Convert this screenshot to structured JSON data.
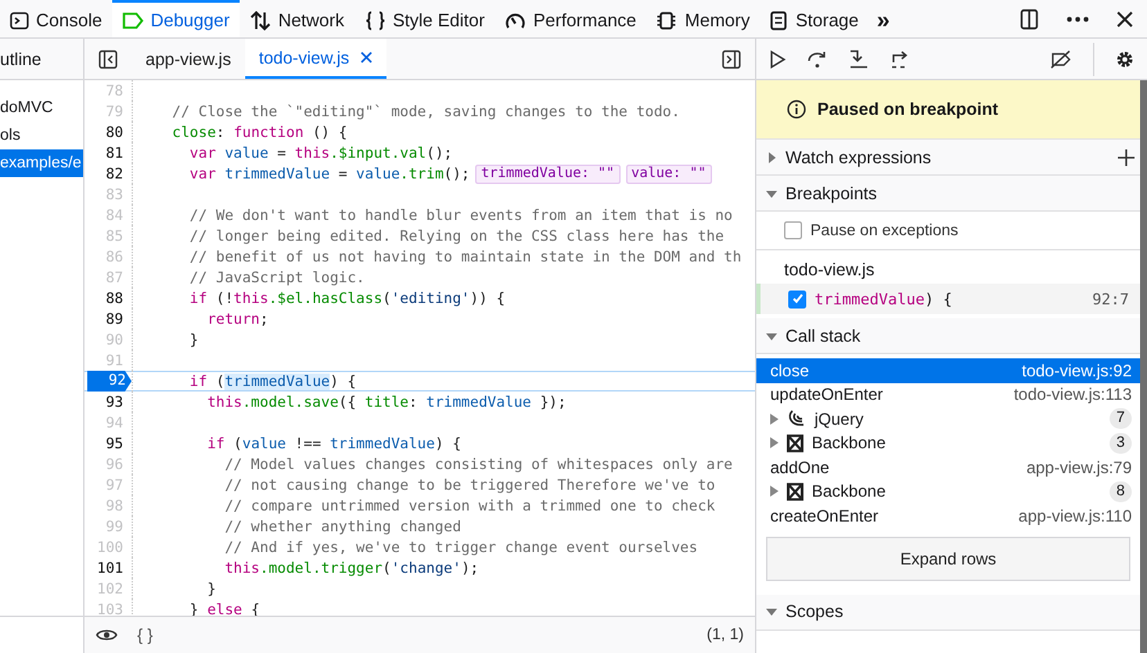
{
  "toolbox_tabs": [
    {
      "label": "Console",
      "selected": false
    },
    {
      "label": "Debugger",
      "selected": true
    },
    {
      "label": "Network",
      "selected": false
    },
    {
      "label": "Style Editor",
      "selected": false
    },
    {
      "label": "Performance",
      "selected": false
    },
    {
      "label": "Memory",
      "selected": false
    },
    {
      "label": "Storage",
      "selected": false
    }
  ],
  "overflow_button": "»",
  "sources_panel": {
    "tab": "utline",
    "items": [
      {
        "label": "doMVC",
        "selected": false
      },
      {
        "label": "ols",
        "selected": false
      },
      {
        "label": "examples/e",
        "selected": true
      }
    ]
  },
  "editor_tabs": [
    {
      "label": "app-view.js",
      "selected": false
    },
    {
      "label": "todo-view.js",
      "selected": true
    }
  ],
  "code_lines": [
    {
      "number": "78",
      "executable": false,
      "breakpoint": false
    },
    {
      "number": "79",
      "executable": false,
      "breakpoint": false,
      "tokens": [
        {
          "text": "    // Close the `\"editing\"` mode, saving changes to the todo.",
          "kind": "comment"
        }
      ]
    },
    {
      "number": "80",
      "executable": true,
      "breakpoint": false,
      "tokens": [
        {
          "text": "    close",
          "kind": "property"
        },
        {
          "text": ": ",
          "kind": "plain"
        },
        {
          "text": "function",
          "kind": "keyword"
        },
        {
          "text": " () {",
          "kind": "plain"
        }
      ]
    },
    {
      "number": "81",
      "executable": true,
      "breakpoint": false,
      "tokens": [
        {
          "text": "      var ",
          "kind": "keyword"
        },
        {
          "text": "value",
          "kind": "variable"
        },
        {
          "text": " = ",
          "kind": "plain"
        },
        {
          "text": "this",
          "kind": "keyword"
        },
        {
          "text": ".$input.val",
          "kind": "property"
        },
        {
          "text": "();",
          "kind": "plain"
        }
      ]
    },
    {
      "number": "82",
      "executable": true,
      "breakpoint": false,
      "tokens": [
        {
          "text": "      var ",
          "kind": "keyword"
        },
        {
          "text": "trimmedValue",
          "kind": "variable"
        },
        {
          "text": " = ",
          "kind": "plain"
        },
        {
          "text": "value",
          "kind": "variable"
        },
        {
          "text": ".trim",
          "kind": "property"
        },
        {
          "text": "();",
          "kind": "plain"
        }
      ],
      "previews": [
        "trimmedValue: \"\"",
        "value: \"\""
      ]
    },
    {
      "number": "83",
      "executable": false,
      "breakpoint": false
    },
    {
      "number": "84",
      "executable": false,
      "breakpoint": false,
      "tokens": [
        {
          "text": "      // We don't want to handle blur events from an item that is no",
          "kind": "comment"
        }
      ]
    },
    {
      "number": "85",
      "executable": false,
      "breakpoint": false,
      "tokens": [
        {
          "text": "      // longer being edited. Relying on the CSS class here has the",
          "kind": "comment"
        }
      ]
    },
    {
      "number": "86",
      "executable": false,
      "breakpoint": false,
      "tokens": [
        {
          "text": "      // benefit of us not having to maintain state in the DOM and th",
          "kind": "comment"
        }
      ]
    },
    {
      "number": "87",
      "executable": false,
      "breakpoint": false,
      "tokens": [
        {
          "text": "      // JavaScript logic.",
          "kind": "comment"
        }
      ]
    },
    {
      "number": "88",
      "executable": true,
      "breakpoint": false,
      "tokens": [
        {
          "text": "      if",
          "kind": "keyword"
        },
        {
          "text": " (!",
          "kind": "plain"
        },
        {
          "text": "this",
          "kind": "keyword"
        },
        {
          "text": ".$el.hasClass",
          "kind": "property"
        },
        {
          "text": "(",
          "kind": "plain"
        },
        {
          "text": "'editing'",
          "kind": "string"
        },
        {
          "text": ")) {",
          "kind": "plain"
        }
      ]
    },
    {
      "number": "89",
      "executable": true,
      "breakpoint": false,
      "tokens": [
        {
          "text": "        return",
          "kind": "keyword"
        },
        {
          "text": ";",
          "kind": "plain"
        }
      ]
    },
    {
      "number": "90",
      "executable": false,
      "breakpoint": false,
      "tokens": [
        {
          "text": "      }",
          "kind": "plain"
        }
      ]
    },
    {
      "number": "91",
      "executable": false,
      "breakpoint": false
    },
    {
      "number": "92",
      "executable": true,
      "breakpoint": true,
      "tokens": [
        {
          "text": "      if",
          "kind": "keyword"
        },
        {
          "text": " (",
          "kind": "plain"
        },
        {
          "text": "trimmedValue",
          "kind": "selected"
        },
        {
          "text": ") {",
          "kind": "plain"
        }
      ]
    },
    {
      "number": "93",
      "executable": true,
      "breakpoint": false,
      "tokens": [
        {
          "text": "        this",
          "kind": "keyword"
        },
        {
          "text": ".model.save",
          "kind": "property"
        },
        {
          "text": "({ ",
          "kind": "plain"
        },
        {
          "text": "title",
          "kind": "property"
        },
        {
          "text": ": ",
          "kind": "plain"
        },
        {
          "text": "trimmedValue",
          "kind": "variable"
        },
        {
          "text": " });",
          "kind": "plain"
        }
      ]
    },
    {
      "number": "94",
      "executable": false,
      "breakpoint": false
    },
    {
      "number": "95",
      "executable": true,
      "breakpoint": false,
      "tokens": [
        {
          "text": "        if",
          "kind": "keyword"
        },
        {
          "text": " (",
          "kind": "plain"
        },
        {
          "text": "value",
          "kind": "variable"
        },
        {
          "text": " !== ",
          "kind": "plain"
        },
        {
          "text": "trimmedValue",
          "kind": "variable"
        },
        {
          "text": ") {",
          "kind": "plain"
        }
      ]
    },
    {
      "number": "96",
      "executable": false,
      "breakpoint": false,
      "tokens": [
        {
          "text": "          // Model values changes consisting of whitespaces only are",
          "kind": "comment"
        }
      ]
    },
    {
      "number": "97",
      "executable": false,
      "breakpoint": false,
      "tokens": [
        {
          "text": "          // not causing change to be triggered Therefore we've to",
          "kind": "comment"
        }
      ]
    },
    {
      "number": "98",
      "executable": false,
      "breakpoint": false,
      "tokens": [
        {
          "text": "          // compare untrimmed version with a trimmed one to check",
          "kind": "comment"
        }
      ]
    },
    {
      "number": "99",
      "executable": false,
      "breakpoint": false,
      "tokens": [
        {
          "text": "          // whether anything changed",
          "kind": "comment"
        }
      ]
    },
    {
      "number": "100",
      "executable": false,
      "breakpoint": false,
      "tokens": [
        {
          "text": "          // And if yes, we've to trigger change event ourselves",
          "kind": "comment"
        }
      ]
    },
    {
      "number": "101",
      "executable": true,
      "breakpoint": false,
      "tokens": [
        {
          "text": "          this",
          "kind": "keyword"
        },
        {
          "text": ".model.trigger",
          "kind": "property"
        },
        {
          "text": "(",
          "kind": "plain"
        },
        {
          "text": "'change'",
          "kind": "string"
        },
        {
          "text": ");",
          "kind": "plain"
        }
      ]
    },
    {
      "number": "102",
      "executable": false,
      "breakpoint": false,
      "tokens": [
        {
          "text": "        }",
          "kind": "plain"
        }
      ]
    },
    {
      "number": "103",
      "executable": false,
      "breakpoint": false,
      "tokens": [
        {
          "text": "      } ",
          "kind": "plain"
        },
        {
          "text": "else",
          "kind": "keyword"
        },
        {
          "text": " {",
          "kind": "plain"
        }
      ]
    }
  ],
  "editor_footer": {
    "format_button": "{ }",
    "cursor_position": "(1, 1)"
  },
  "pause_banner": "Paused on breakpoint",
  "watch_expressions": {
    "title": "Watch expressions",
    "expanded": false
  },
  "breakpoints": {
    "title": "Breakpoints",
    "expanded": true,
    "pause_on_exceptions": {
      "label": "Pause on exceptions",
      "checked": false
    },
    "files": [
      {
        "name": "todo-view.js",
        "items": [
          {
            "text": "trimmedValue",
            "rest": ") {",
            "location": "92:7",
            "checked": true
          }
        ]
      }
    ]
  },
  "call_stack": {
    "title": "Call stack",
    "expanded": true,
    "frames": [
      {
        "kind": "frame",
        "name": "close",
        "location": "todo-view.js:92",
        "selected": true
      },
      {
        "kind": "frame",
        "name": "updateOnEnter",
        "location": "todo-view.js:113",
        "selected": false
      },
      {
        "kind": "jquery",
        "name": "jQuery",
        "count": "7",
        "selected": false
      },
      {
        "kind": "backbone",
        "name": "Backbone",
        "count": "3",
        "selected": false
      },
      {
        "kind": "frame",
        "name": "addOne",
        "location": "app-view.js:79",
        "selected": false
      },
      {
        "kind": "backbone",
        "name": "Backbone",
        "count": "8",
        "selected": false
      },
      {
        "kind": "frame",
        "name": "createOnEnter",
        "location": "app-view.js:110",
        "selected": false
      }
    ],
    "expand_button": "Expand rows"
  },
  "scopes": {
    "title": "Scopes",
    "expanded": true
  }
}
